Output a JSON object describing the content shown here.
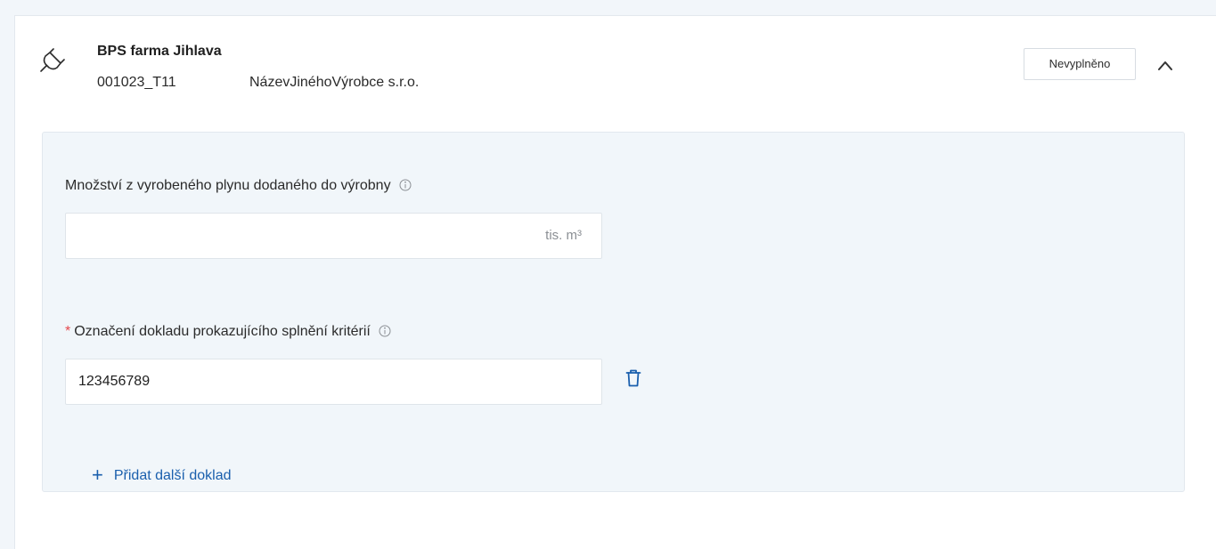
{
  "header": {
    "title": "BPS farma Jihlava",
    "code": "001023_T11",
    "producer": "NázevJinéhoVýrobce s.r.o.",
    "status": "Nevyplněno",
    "icon": "plug-icon",
    "collapse_icon": "chevron-up-icon"
  },
  "fields": {
    "gas_quantity": {
      "label": "Množství z vyrobeného plynu dodaného do výrobny",
      "value": "",
      "unit": "tis. m³"
    },
    "document_id": {
      "required_mark": "*",
      "label": "Označení dokladu prokazujícího splnění kritérií",
      "value": "123456789"
    }
  },
  "actions": {
    "add_document_plus": "+",
    "add_document_label": "Přidat další doklad"
  },
  "colors": {
    "page_bg": "#f2f6fa",
    "panel_bg": "#f1f6fa",
    "link": "#1a5fad",
    "required": "#e5484d"
  }
}
